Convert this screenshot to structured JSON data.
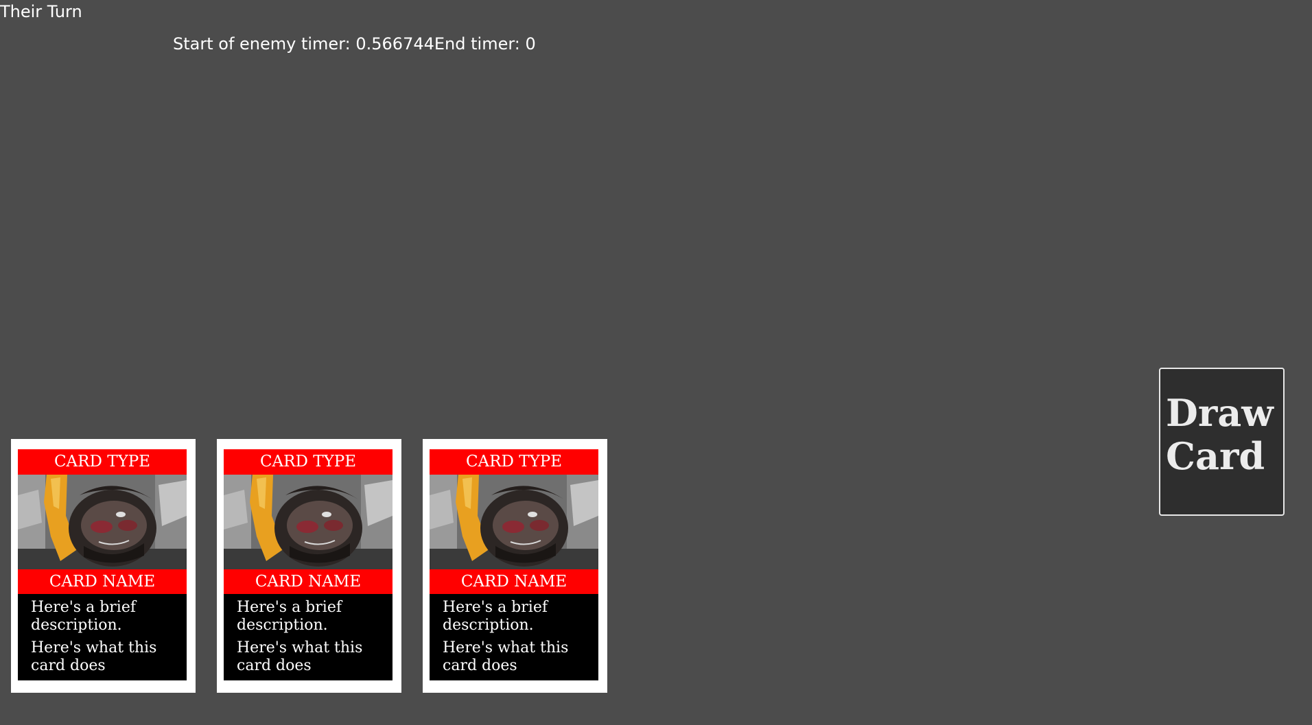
{
  "status": {
    "turn_label": "Their Turn",
    "timer_text": "Start of enemy timer: 0.566744End timer: 0"
  },
  "hand": {
    "cards": [
      {
        "type_label": "CARD TYPE",
        "name_label": "CARD NAME",
        "description": "Here's a brief description.",
        "effect": "Here's what this card does"
      },
      {
        "type_label": "CARD TYPE",
        "name_label": "CARD NAME",
        "description": "Here's a brief description.",
        "effect": "Here's what this card does"
      },
      {
        "type_label": "CARD TYPE",
        "name_label": "CARD NAME",
        "description": "Here's a brief description.",
        "effect": "Here's what this card does"
      }
    ]
  },
  "draw_button": {
    "label": "Draw\nCard"
  },
  "colors": {
    "background": "#4c4c4c",
    "card_banner": "#ff0000",
    "card_frame": "#ffffff",
    "card_body": "#000000",
    "draw_button_fill": "#2e2e2e"
  }
}
